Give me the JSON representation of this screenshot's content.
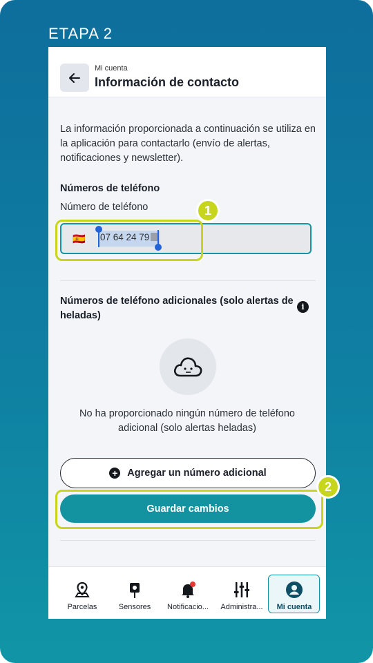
{
  "stage_label": "ETAPA 2",
  "header": {
    "subtitle": "Mi cuenta",
    "title": "Información de contacto"
  },
  "intro_text": "La información proporcionada a continuación se utiliza en la aplicación para contactarlo (envío de alertas, notificaciones y newsletter).",
  "phone_section": {
    "title": "Números de teléfono",
    "field_label": "Número de teléfono",
    "flag": "🇪🇸",
    "value": "07 64 24 79"
  },
  "additional_section": {
    "title": "Números de teléfono adicionales (solo alertas de heladas)",
    "empty_text": "No ha proporcionado ningún número de teléfono adicional (solo alertas heladas)"
  },
  "buttons": {
    "add_label": "Agregar un número adicional",
    "save_label": "Guardar cambios"
  },
  "annotations": {
    "step1": "1",
    "step2": "2",
    "highlight_color": "#c7d61c"
  },
  "colors": {
    "accent": "#13939f",
    "notification_dot": "#e53935"
  },
  "bottom_nav": [
    {
      "label": "Parcelas",
      "icon": "map-pin-icon"
    },
    {
      "label": "Sensores",
      "icon": "sensor-icon"
    },
    {
      "label": "Notificacio...",
      "icon": "bell-icon"
    },
    {
      "label": "Administra...",
      "icon": "sliders-icon"
    },
    {
      "label": "Mi cuenta",
      "icon": "account-icon",
      "active": true
    }
  ]
}
